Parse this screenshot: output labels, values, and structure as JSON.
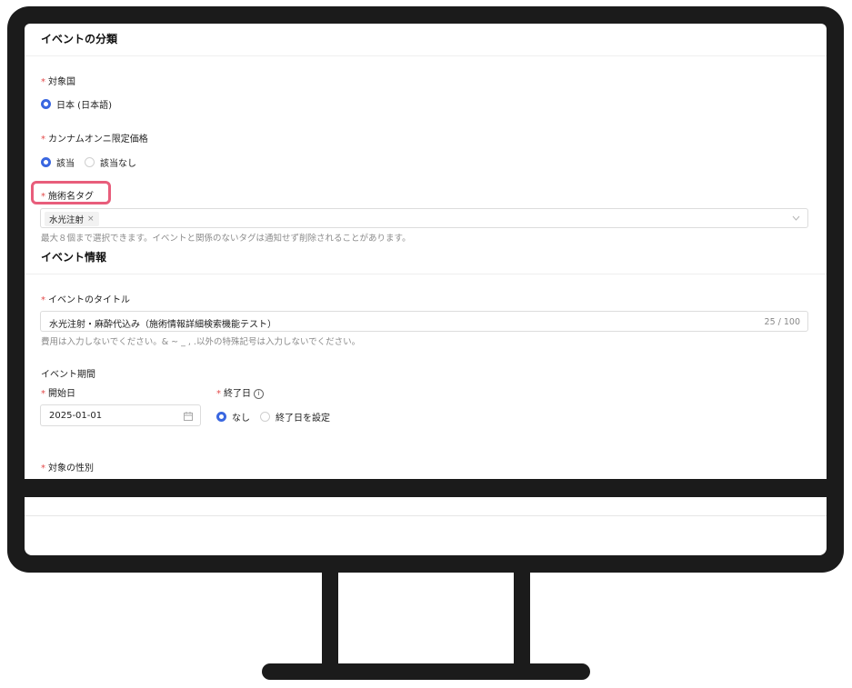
{
  "classification": {
    "section_title": "イベントの分類",
    "country": {
      "label": "対象国",
      "options": [
        {
          "label": "日本 (日本語)",
          "selected": true
        }
      ]
    },
    "limited_price": {
      "label": "カンナムオンニ限定価格",
      "options": [
        {
          "label": "該当",
          "selected": true
        },
        {
          "label": "該当なし",
          "selected": false
        }
      ]
    },
    "treatment_tag": {
      "label": "施術名タグ",
      "tags": [
        "水光注射"
      ],
      "tag_remove": "×",
      "dropdown_icon": "chevron-down-icon",
      "hint": "最大８個まで選択できます。イベントと関係のないタグは通知せず削除されることがあります。"
    }
  },
  "event_info": {
    "section_title": "イベント情報",
    "title_field": {
      "label": "イベントのタイトル",
      "value": "水光注射・麻酔代込み（施術情報詳細検索機能テスト）",
      "counter": "25 / 100",
      "hint": "費用は入力しないでください。& ~ _ , .以外の特殊記号は入力しないでください。"
    },
    "period": {
      "label": "イベント期間",
      "start": {
        "label": "開始日",
        "value": "2025-01-01",
        "icon": "calendar-icon"
      },
      "end": {
        "label": "終了日",
        "info_icon": "ⓘ",
        "options": [
          {
            "label": "なし",
            "selected": true
          },
          {
            "label": "終了日を設定",
            "selected": false
          }
        ]
      }
    },
    "gender": {
      "label": "対象の性別"
    }
  },
  "required_mark": "*",
  "colors": {
    "accent": "#3a67e0",
    "required": "#e34b4b",
    "highlight": "#e85d7b",
    "frame": "#1b1b1b"
  }
}
